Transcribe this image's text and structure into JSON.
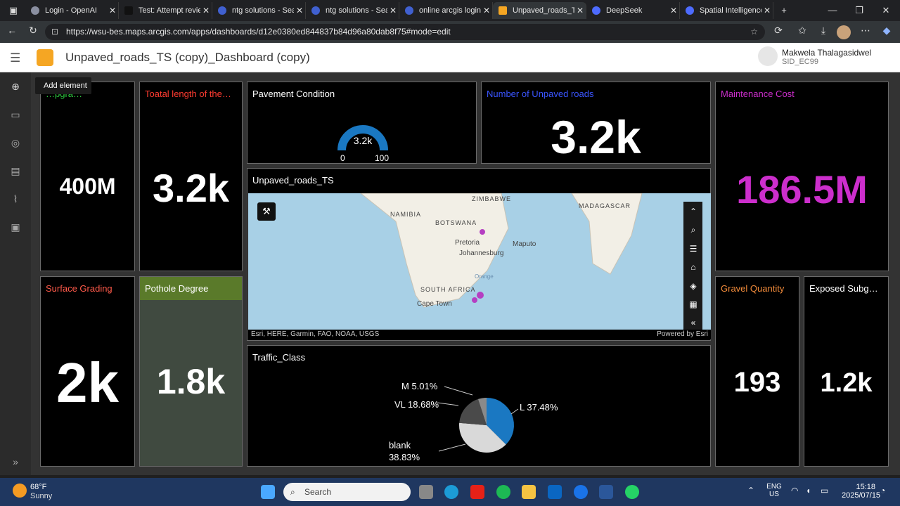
{
  "browser": {
    "tabs": [
      {
        "title": "Login - OpenAI"
      },
      {
        "title": "Test: Attempt revie"
      },
      {
        "title": "ntg solutions - Sea"
      },
      {
        "title": "ntg solutions - Sea"
      },
      {
        "title": "online arcgis login"
      },
      {
        "title": "Unpaved_roads_TS"
      },
      {
        "title": "DeepSeek"
      },
      {
        "title": "Spatial Intelligence"
      }
    ],
    "url": "https://wsu-bes.maps.arcgis.com/apps/dashboards/d12e0380ed844837b84d96a80dab8f75#mode=edit"
  },
  "app": {
    "title": "Unpaved_roads_TS (copy)_Dashboard (copy)",
    "user_name": "Makwela Thalagasidwel",
    "user_id": "SID_EC99",
    "tooltip": "Add element"
  },
  "cards": {
    "upgrade": {
      "title": "…pgra…",
      "value": "400M",
      "color": "#2ecc40"
    },
    "total_length": {
      "title": "Toatal length of the…",
      "value": "3.2k",
      "color": "#ff3b30"
    },
    "pavement": {
      "title": "Pavement Condition",
      "gauge_value": "3.2k",
      "gauge_min": "0",
      "gauge_max": "100"
    },
    "unpaved_count": {
      "title": "Number of Unpaved roads",
      "value": "3.2k",
      "color": "#3a55ff"
    },
    "maintenance": {
      "title": "Maintenance Cost",
      "value": "186.5M",
      "color": "#cc2ecc"
    },
    "map": {
      "title": "Unpaved_roads_TS",
      "attribution": "Esri, HERE, Garmin, FAO, NOAA, USGS",
      "powered": "Powered by Esri",
      "labels": {
        "zimbabwe": "ZIMBABWE",
        "namibia": "NAMIBIA",
        "botswana": "BOTSWANA",
        "madagascar": "MADAGASCAR",
        "pretoria": "Pretoria",
        "johannesburg": "Johannesburg",
        "maputo": "Maputo",
        "south_africa": "SOUTH AFRICA",
        "cape_town": "Cape Town",
        "orange": "Orange"
      }
    },
    "surface": {
      "title": "Surface Grading",
      "value": "2k",
      "color": "#ff5a4a"
    },
    "pothole": {
      "title": "Pothole Degree",
      "value": "1.8k",
      "color": "#5a7a2a"
    },
    "traffic": {
      "title": "Traffic_Class"
    },
    "gravel": {
      "title": "Gravel Quantity",
      "value": "193",
      "color": "#f08a3a"
    },
    "subgrade": {
      "title": "Exposed Subg…",
      "value": "1.2k"
    }
  },
  "chart_data": {
    "type": "pie",
    "title": "Traffic_Class",
    "slices": [
      {
        "label": "L",
        "value": 37.48,
        "color": "#1a78c2"
      },
      {
        "label": "blank",
        "value": 38.83,
        "color": "#d9d9d9"
      },
      {
        "label": "VL",
        "value": 18.68,
        "color": "#4a4a4a"
      },
      {
        "label": "M",
        "value": 5.01,
        "color": "#8a8a8a"
      }
    ],
    "labels": {
      "L": "L 37.48%",
      "blank_l1": "blank",
      "blank_l2": "38.83%",
      "VL": "VL 18.68%",
      "M": "M 5.01%"
    }
  },
  "taskbar": {
    "weather_temp": "68°F",
    "weather_desc": "Sunny",
    "search_placeholder": "Search",
    "lang": "ENG",
    "region": "US",
    "time": "15:18",
    "date": "2025/07/15"
  }
}
